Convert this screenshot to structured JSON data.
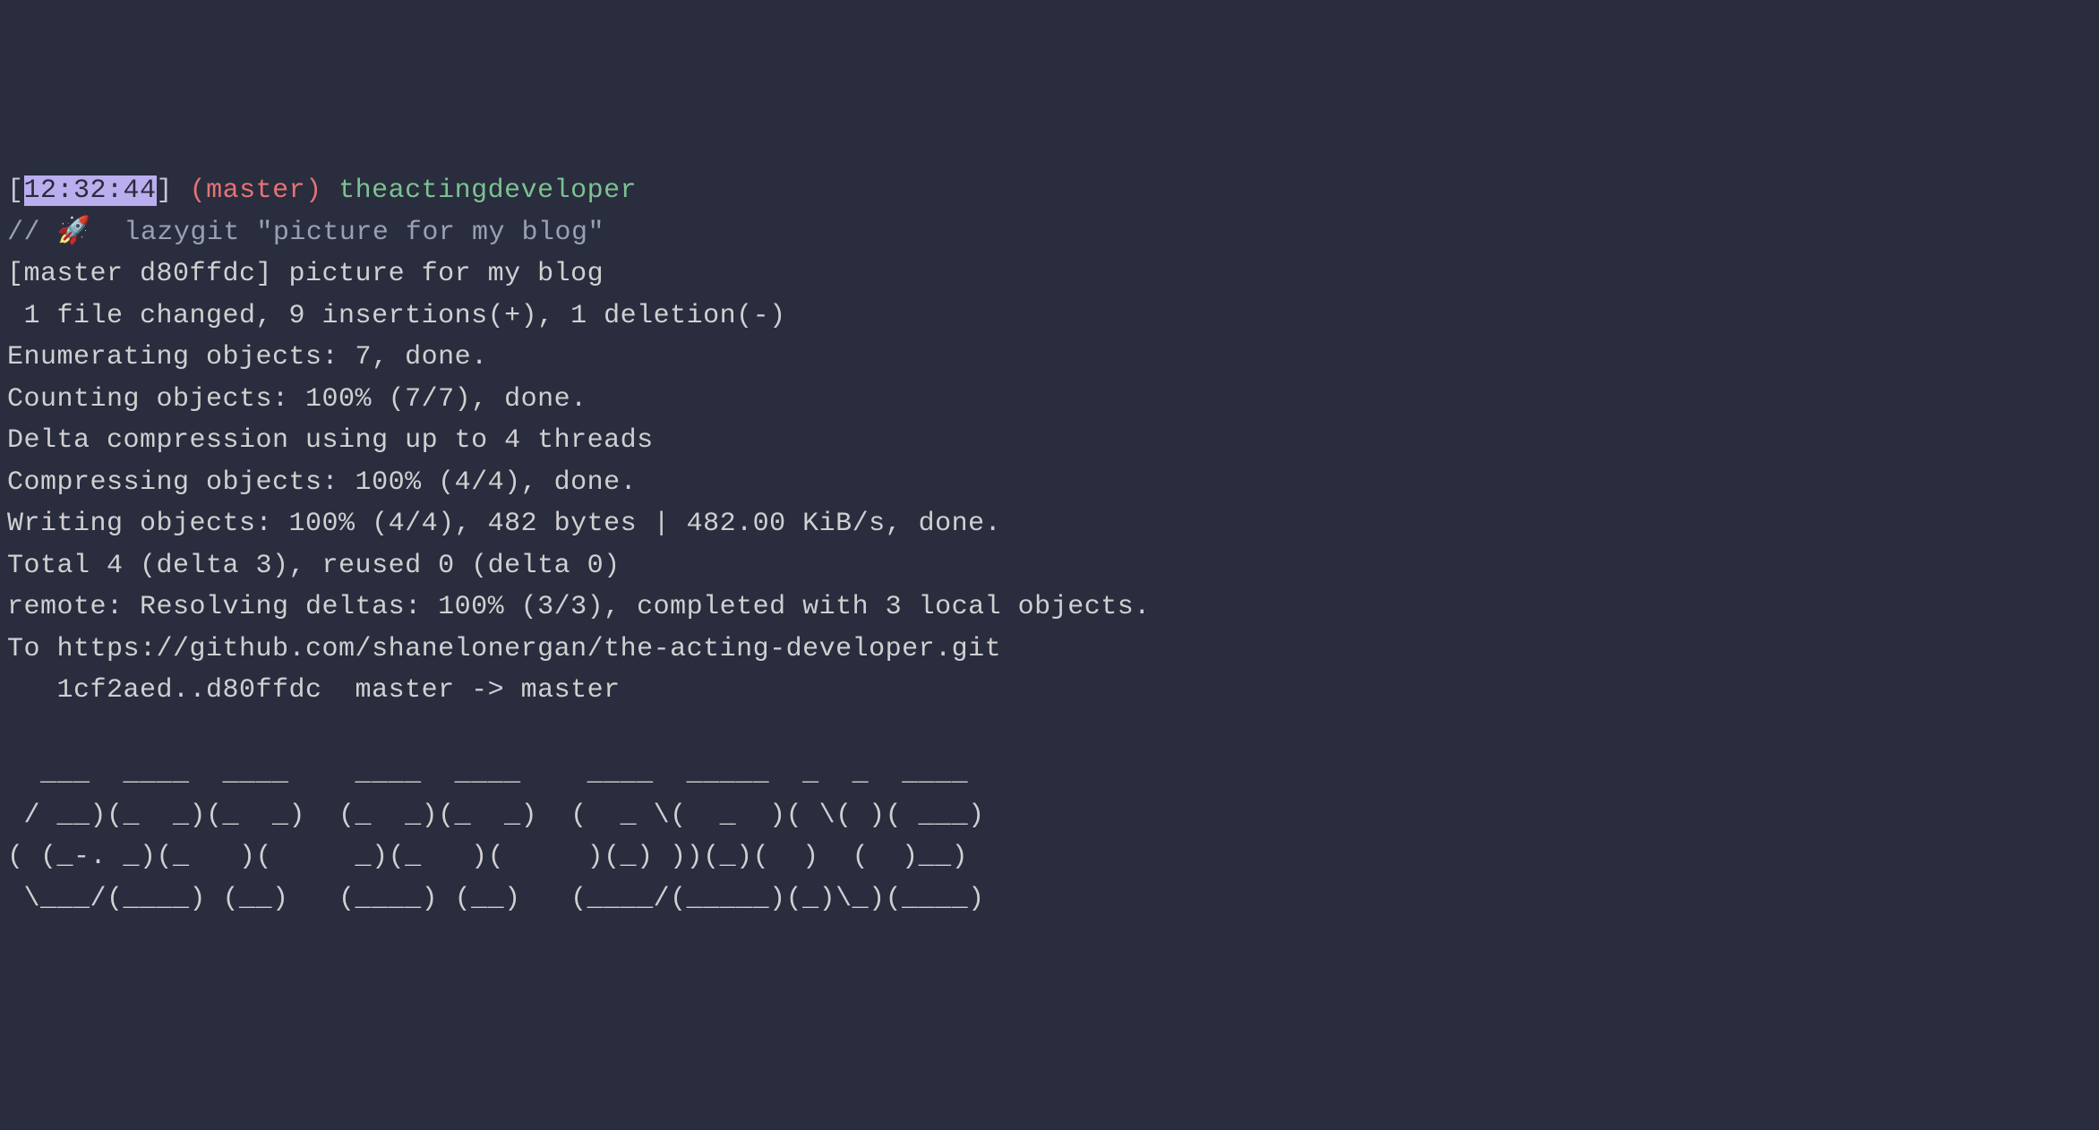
{
  "prompt": {
    "bracket_open": "[",
    "timestamp": "12:32:44",
    "bracket_close": "]",
    "branch": "(master)",
    "path": "theactingdeveloper"
  },
  "command": {
    "prefix": "// ",
    "emoji": "🚀",
    "text": "  lazygit \"picture for my blog\""
  },
  "output": {
    "line1": "[master d80ffdc] picture for my blog",
    "line2": " 1 file changed, 9 insertions(+), 1 deletion(-)",
    "line3": "Enumerating objects: 7, done.",
    "line4": "Counting objects: 100% (7/7), done.",
    "line5": "Delta compression using up to 4 threads",
    "line6": "Compressing objects: 100% (4/4), done.",
    "line7": "Writing objects: 100% (4/4), 482 bytes | 482.00 KiB/s, done.",
    "line8": "Total 4 (delta 3), reused 0 (delta 0)",
    "line9": "remote: Resolving deltas: 100% (3/3), completed with 3 local objects.",
    "line10": "To https://github.com/shanelonergan/the-acting-developer.git",
    "line11": "   1cf2aed..d80ffdc  master -> master"
  },
  "ascii": {
    "line1": "  ___  ____  ____    ____  ____    ____  _____  _  _  ____ ",
    "line2": " / __)(_  _)(_  _)  (_  _)(_  _)  (  _ \\(  _  )( \\( )( ___)",
    "line3": "( (_-. _)(_   )(     _)(_   )(     )(_) ))(_)(  )  (  )__) ",
    "line4": " \\___/(____) (__)   (____) (__)   (____/(_____)(_)\\_)(____)"
  }
}
